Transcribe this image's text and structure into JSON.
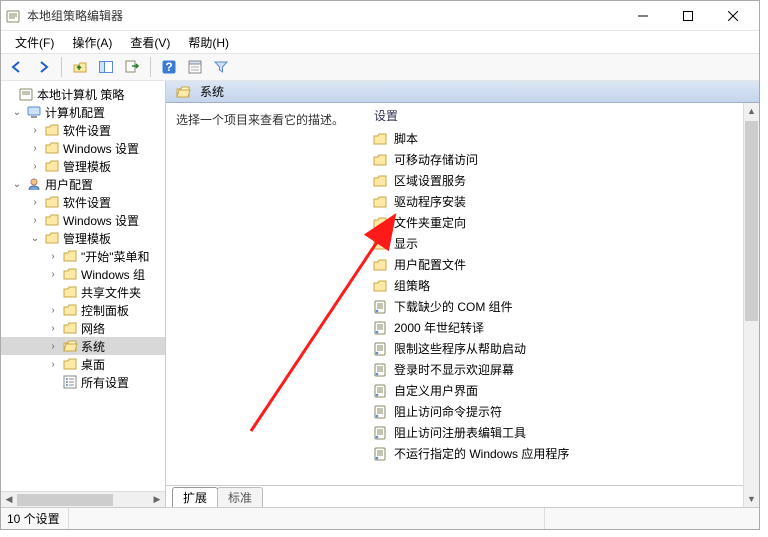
{
  "window": {
    "title": "本地组策略编辑器"
  },
  "menu": {
    "file": "文件(F)",
    "action": "操作(A)",
    "view": "查看(V)",
    "help": "帮助(H)"
  },
  "toolbar_icons": {
    "back": "back-arrow-icon",
    "forward": "forward-arrow-icon",
    "up": "up-level-icon",
    "show_hide_tree": "show-hide-tree-icon",
    "export": "export-list-icon",
    "help": "help-icon",
    "properties": "properties-icon",
    "filter": "filter-icon"
  },
  "tree": {
    "root": "本地计算机 策略",
    "computer_config": "计算机配置",
    "cc_software": "软件设置",
    "cc_windows": "Windows 设置",
    "cc_templates": "管理模板",
    "user_config": "用户配置",
    "uc_software": "软件设置",
    "uc_windows": "Windows 设置",
    "uc_templates": "管理模板",
    "t_start": "\"开始\"菜单和",
    "t_wincomp": "Windows 组",
    "t_shared": "共享文件夹",
    "t_control": "控制面板",
    "t_network": "网络",
    "t_system": "系统",
    "t_desktop": "桌面",
    "t_all": "所有设置"
  },
  "details": {
    "header_title": "系统",
    "description_prompt": "选择一个项目来查看它的描述。",
    "settings_header": "设置",
    "folders": [
      "脚本",
      "可移动存储访问",
      "区域设置服务",
      "驱动程序安装",
      "文件夹重定向",
      "显示",
      "用户配置文件",
      "组策略"
    ],
    "policies": [
      "下载缺少的 COM 组件",
      "2000 年世纪转译",
      "限制这些程序从帮助启动",
      "登录时不显示欢迎屏幕",
      "自定义用户界面",
      "阻止访问命令提示符",
      "阻止访问注册表编辑工具",
      "不运行指定的 Windows 应用程序"
    ]
  },
  "tabs": {
    "extended": "扩展",
    "standard": "标准"
  },
  "statusbar": {
    "text": "10 个设置"
  }
}
